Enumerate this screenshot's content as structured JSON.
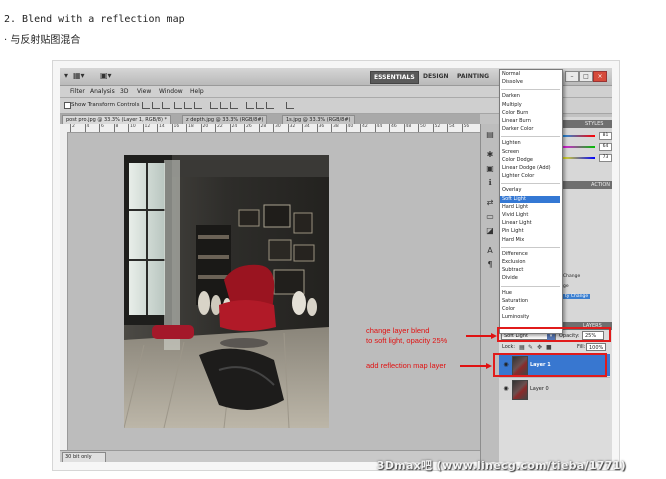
{
  "page": {
    "heading": "2. Blend with a reflection map",
    "subheading": "· 与反射贴图混合",
    "watermark": "3Dmax吧 (www.linecg.com/tieba/1771)"
  },
  "photoshop": {
    "workspaces": [
      "ESSENTIALS",
      "DESIGN",
      "PAINTING"
    ],
    "menu": [
      "Filter",
      "Analysis",
      "3D",
      "View",
      "Window",
      "Help"
    ],
    "options": {
      "show_transform_controls": "Show Transform Controls"
    },
    "tabs": [
      "post pro.jpg @ 33.3% (Layer 1, RGB/8) *",
      "z depth.jpg @ 33.3% (RGB/8#)",
      "1s.jpg @ 33.3% (RGB/8#)"
    ],
    "ruler_numbers": [
      "2",
      "4",
      "6",
      "8",
      "10",
      "12",
      "14",
      "16",
      "18",
      "20",
      "22",
      "24",
      "26",
      "28",
      "30",
      "32",
      "34",
      "36",
      "38",
      "40",
      "42",
      "44",
      "46",
      "48",
      "50",
      "52",
      "54",
      "56"
    ],
    "status": "30 bit only",
    "color_values": {
      "r": "81",
      "g": "64",
      "b": "73"
    },
    "panel_tabs": {
      "styles": "STYLES",
      "action": "ACTION"
    },
    "history": [
      "Change",
      "ge",
      "ty Change"
    ],
    "blend_modes": [
      [
        "Normal",
        "Dissolve"
      ],
      [
        "Darken",
        "Multiply",
        "Color Burn",
        "Linear Burn",
        "Darker Color"
      ],
      [
        "Lighten",
        "Screen",
        "Color Dodge",
        "Linear Dodge (Add)",
        "Lighter Color"
      ],
      [
        "Overlay",
        "Soft Light",
        "Hard Light",
        "Vivid Light",
        "Linear Light",
        "Pin Light",
        "Hard Mix"
      ],
      [
        "Difference",
        "Exclusion",
        "Subtract",
        "Divide"
      ],
      [
        "Hue",
        "Saturation",
        "Color",
        "Luminosity"
      ]
    ],
    "blend_selected": "Soft Light",
    "layers_panel": {
      "tab": "LAYERS",
      "blend_mode": "Soft Light",
      "opacity_label": "Opacity:",
      "opacity": "25%",
      "lock_label": "Lock:",
      "fill_label": "Fill:",
      "fill": "100%",
      "layers": [
        {
          "name": "Layer 1",
          "selected": true
        },
        {
          "name": "Layer 0",
          "selected": false
        }
      ]
    }
  },
  "annotations": {
    "blend_note_line1": "change layer blend",
    "blend_note_line2": "to soft light, opacity 25%",
    "layer_note": "add reflection map layer"
  },
  "colors": {
    "annotation_red": "#e01212",
    "selection_blue": "#3878d2"
  }
}
